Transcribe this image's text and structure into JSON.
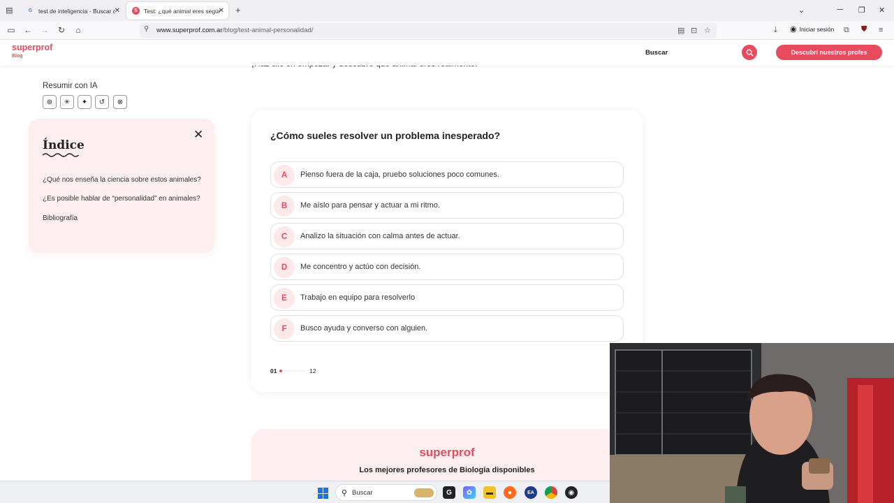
{
  "browser": {
    "tabs": [
      {
        "title": "test de inteligencia - Buscar con",
        "active": false
      },
      {
        "title": "Test: ¿qué animal eres según tu",
        "active": true
      }
    ],
    "url_domain": "www.superprof.com.ar",
    "url_path": "/blog/test-animal-personalidad/",
    "signin_label": "Iniciar sesión"
  },
  "site_header": {
    "logo": "superprof",
    "logo_sub": "Blog",
    "search_label": "Buscar",
    "cta_label": "Descubrí nuestros profes",
    "brand_color": "#e84b5e"
  },
  "intro_cut_text": "¡Haz clic en empezar y descubre qué animal eres realmente!",
  "resumir": {
    "label": "Resumir con IA",
    "icons": [
      "chatgpt-icon",
      "claude-icon",
      "gemini-icon",
      "perplexity-icon",
      "grok-icon"
    ]
  },
  "indice": {
    "title": "Índice",
    "links": [
      "¿Qué nos enseña la ciencia sobre estos animales?",
      "¿Es posible hablar de “personalidad” en animales?",
      "Bibliografía"
    ]
  },
  "quiz": {
    "question": "¿Cómo sueles resolver un problema inesperado?",
    "options": [
      {
        "letter": "A",
        "text": "Pienso fuera de la caja, pruebo soluciones poco comunes."
      },
      {
        "letter": "B",
        "text": "Me aíslo para pensar y actuar a mi ritmo."
      },
      {
        "letter": "C",
        "text": "Analizo la situación con calma antes de actuar."
      },
      {
        "letter": "D",
        "text": "Me concentro y actúo con decisión."
      },
      {
        "letter": "E",
        "text": "Trabajo en equipo para resolverlo"
      },
      {
        "letter": "F",
        "text": "Busco ayuda y converso con alguien."
      }
    ],
    "progress_current": "01",
    "progress_total": "12",
    "progress_fraction": 0.083
  },
  "promo": {
    "logo": "superprof",
    "title": "Los mejores profesores de Biología disponibles"
  },
  "taskbar": {
    "search_label": "Buscar"
  }
}
